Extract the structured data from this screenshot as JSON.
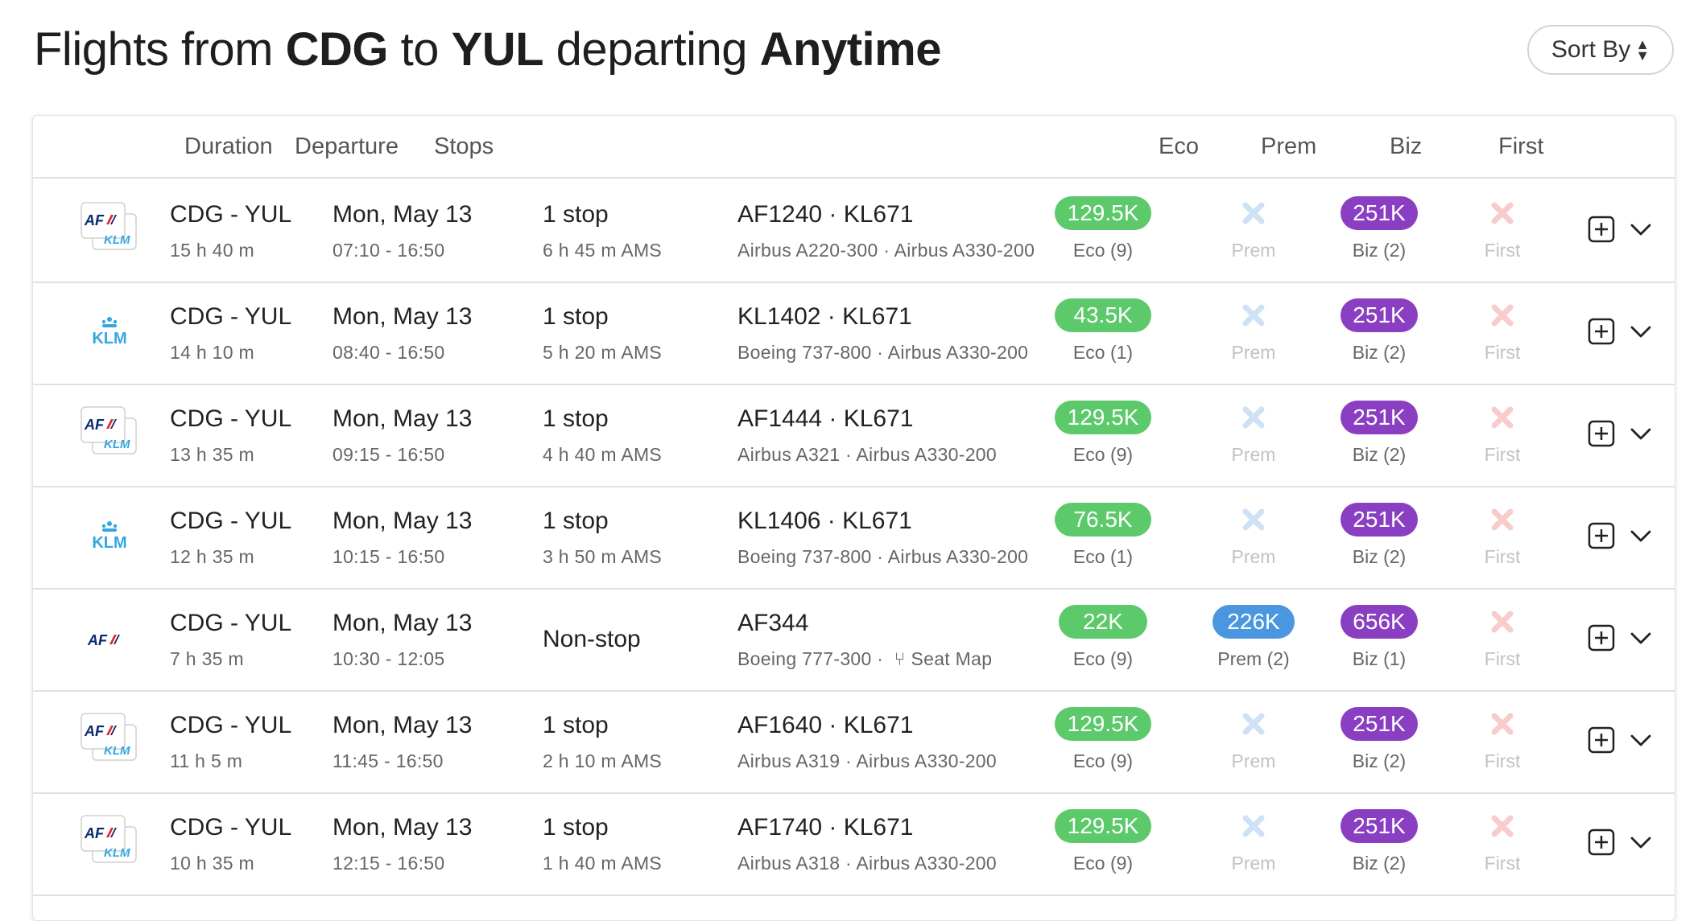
{
  "header": {
    "title_prefix": "Flights from ",
    "origin": "CDG",
    "title_mid": " to ",
    "destination": "YUL",
    "title_suffix": " departing ",
    "when": "Anytime",
    "sort_label": "Sort By"
  },
  "columns": {
    "duration": "Duration",
    "departure": "Departure",
    "stops": "Stops",
    "eco": "Eco",
    "prem": "Prem",
    "biz": "Biz",
    "first": "First"
  },
  "flights": [
    {
      "logo": "af-klm-logo",
      "route": "CDG - YUL",
      "duration": "15 h 40 m",
      "date": "Mon, May 13",
      "times": "07:10 - 16:50",
      "stops": "1 stop",
      "layover": "6 h 45 m  AMS",
      "flight_nums": "AF1240  ·  KL671",
      "aircraft": "Airbus A220-300  ·  Airbus A330-200",
      "eco_price": "129.5K",
      "eco_label": "Eco (9)",
      "prem_price": "",
      "prem_label": "Prem",
      "biz_price": "251K",
      "biz_label": "Biz (2)",
      "first_label": "First"
    },
    {
      "logo": "klm-logo",
      "route": "CDG - YUL",
      "duration": "14 h 10 m",
      "date": "Mon, May 13",
      "times": "08:40 - 16:50",
      "stops": "1 stop",
      "layover": "5 h 20 m  AMS",
      "flight_nums": "KL1402  ·  KL671",
      "aircraft": "Boeing 737-800  ·  Airbus A330-200",
      "eco_price": "43.5K",
      "eco_label": "Eco (1)",
      "prem_price": "",
      "prem_label": "Prem",
      "biz_price": "251K",
      "biz_label": "Biz (2)",
      "first_label": "First"
    },
    {
      "logo": "af-klm-logo",
      "route": "CDG - YUL",
      "duration": "13 h 35 m",
      "date": "Mon, May 13",
      "times": "09:15 - 16:50",
      "stops": "1 stop",
      "layover": "4 h 40 m  AMS",
      "flight_nums": "AF1444  ·  KL671",
      "aircraft": "Airbus A321  ·  Airbus A330-200",
      "eco_price": "129.5K",
      "eco_label": "Eco (9)",
      "prem_price": "",
      "prem_label": "Prem",
      "biz_price": "251K",
      "biz_label": "Biz (2)",
      "first_label": "First"
    },
    {
      "logo": "klm-logo",
      "route": "CDG - YUL",
      "duration": "12 h 35 m",
      "date": "Mon, May 13",
      "times": "10:15 - 16:50",
      "stops": "1 stop",
      "layover": "3 h 50 m  AMS",
      "flight_nums": "KL1406  ·  KL671",
      "aircraft": "Boeing 737-800  ·  Airbus A330-200",
      "eco_price": "76.5K",
      "eco_label": "Eco (1)",
      "prem_price": "",
      "prem_label": "Prem",
      "biz_price": "251K",
      "biz_label": "Biz (2)",
      "first_label": "First"
    },
    {
      "logo": "af-logo",
      "route": "CDG - YUL",
      "duration": "7 h 35 m",
      "date": "Mon, May 13",
      "times": "10:30 - 12:05",
      "stops": "Non-stop",
      "layover": "",
      "flight_nums": "AF344",
      "aircraft": "Boeing 777-300  ·",
      "seat_map": "Seat Map",
      "eco_price": "22K",
      "eco_label": "Eco (9)",
      "prem_price": "226K",
      "prem_label": "Prem (2)",
      "biz_price": "656K",
      "biz_label": "Biz (1)",
      "first_label": "First"
    },
    {
      "logo": "af-klm-logo",
      "route": "CDG - YUL",
      "duration": "11 h 5 m",
      "date": "Mon, May 13",
      "times": "11:45 - 16:50",
      "stops": "1 stop",
      "layover": "2 h 10 m  AMS",
      "flight_nums": "AF1640  ·  KL671",
      "aircraft": "Airbus A319  ·  Airbus A330-200",
      "eco_price": "129.5K",
      "eco_label": "Eco (9)",
      "prem_price": "",
      "prem_label": "Prem",
      "biz_price": "251K",
      "biz_label": "Biz (2)",
      "first_label": "First"
    },
    {
      "logo": "af-klm-logo",
      "route": "CDG - YUL",
      "duration": "10 h 35 m",
      "date": "Mon, May 13",
      "times": "12:15 - 16:50",
      "stops": "1 stop",
      "layover": "1 h 40 m  AMS",
      "flight_nums": "AF1740  ·  KL671",
      "aircraft": "Airbus A318  ·  Airbus A330-200",
      "eco_price": "129.5K",
      "eco_label": "Eco (9)",
      "prem_price": "",
      "prem_label": "Prem",
      "biz_price": "251K",
      "biz_label": "Biz (2)",
      "first_label": "First"
    }
  ],
  "colors": {
    "eco": "#5cc96a",
    "prem": "#4a97df",
    "biz": "#8a3fc2",
    "unavailable_prem": "#cfe2f5",
    "unavailable_first": "#f9cccc",
    "af_red": "#e3262f",
    "af_blue": "#0a2a6c",
    "klm_blue": "#34a7e0"
  }
}
